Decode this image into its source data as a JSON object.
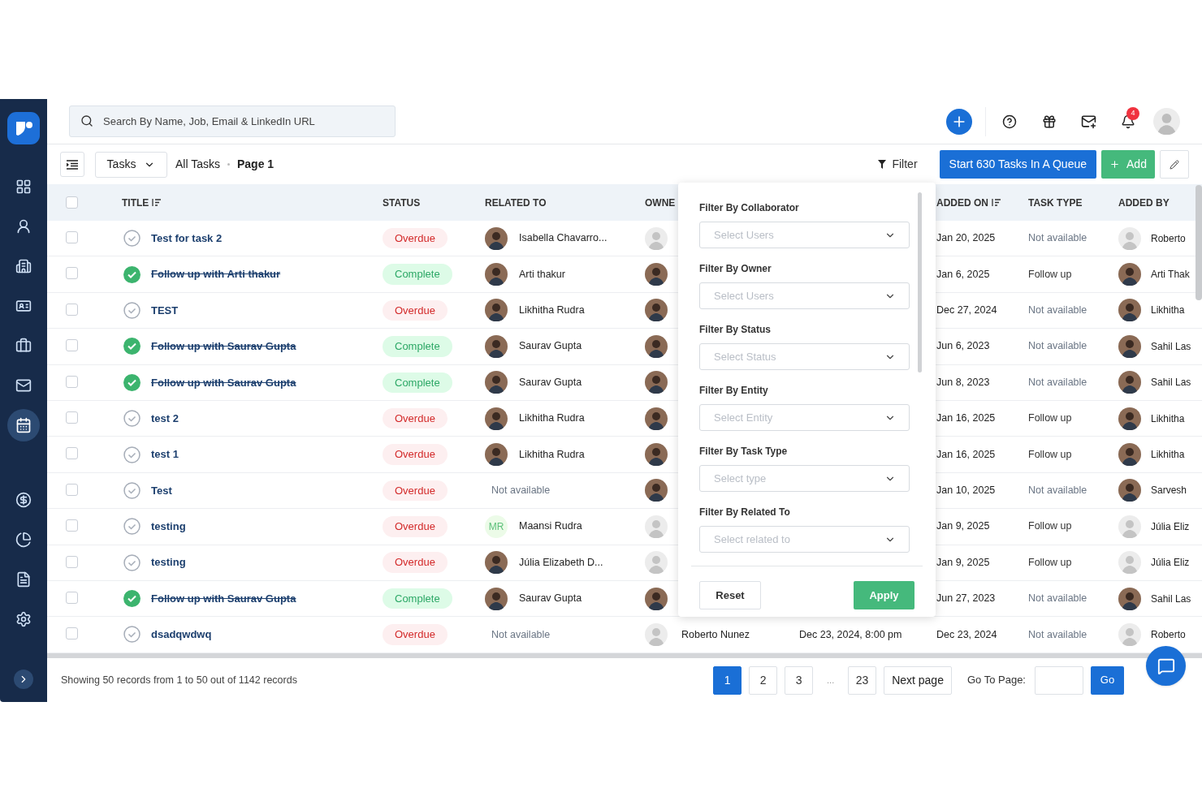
{
  "sidebar": {
    "items": [
      {
        "kind": "grid",
        "selected": false
      },
      {
        "kind": "user",
        "selected": false
      },
      {
        "kind": "building",
        "selected": false
      },
      {
        "kind": "card",
        "selected": false
      },
      {
        "kind": "briefcase",
        "selected": false
      },
      {
        "kind": "mail",
        "selected": false
      },
      {
        "kind": "calendar",
        "selected": true
      },
      {
        "kind": "dollar",
        "selected": false
      },
      {
        "kind": "pie",
        "selected": false
      },
      {
        "kind": "invoice",
        "selected": false
      },
      {
        "kind": "settings",
        "selected": false
      }
    ]
  },
  "header": {
    "search": {
      "placeholder": "Search By Name, Job, Email & LinkedIn URL"
    },
    "notification_count": "4"
  },
  "toolbar": {
    "view": "Tasks",
    "breadcrumb": [
      "All Tasks",
      "Page 1"
    ],
    "filter": "Filter",
    "queue_button": "Start 630 Tasks In A Queue",
    "add_button": "Add"
  },
  "table": {
    "select_all": {
      "checked": false
    },
    "columns": [
      "TITLE",
      "STATUS",
      "RELATED TO",
      "OWNE",
      "ADDED ON",
      "TASK TYPE",
      "ADDED BY"
    ],
    "rows": [
      {
        "checked": false,
        "title": "Test for task 2",
        "done": false,
        "status": {
          "label": "Overdue",
          "kind": "overdue"
        },
        "related": {
          "kind": "photo",
          "name": "Isabella Chavarro..."
        },
        "owner": {
          "kind": "placeholder"
        },
        "added_on": "Jan 20, 2025",
        "task_type": {
          "kind": "none",
          "text": "Not available"
        },
        "added_by": {
          "kind": "placeholder",
          "name": "Roberto"
        }
      },
      {
        "checked": false,
        "title": "Follow up with Arti thakur",
        "done": true,
        "status": {
          "label": "Complete",
          "kind": "complete"
        },
        "related": {
          "kind": "photo",
          "name": "Arti thakur"
        },
        "owner": {
          "kind": "photo"
        },
        "added_on": "Jan 6, 2025",
        "task_type": {
          "kind": "value",
          "text": "Follow up"
        },
        "added_by": {
          "kind": "photo",
          "name": "Arti Thak"
        }
      },
      {
        "checked": false,
        "title": "TEST",
        "done": false,
        "status": {
          "label": "Overdue",
          "kind": "overdue"
        },
        "related": {
          "kind": "photo",
          "name": "Likhitha Rudra"
        },
        "owner": {
          "kind": "photo"
        },
        "added_on": "Dec 27, 2024",
        "task_type": {
          "kind": "none",
          "text": "Not available"
        },
        "added_by": {
          "kind": "photo",
          "name": "Likhitha"
        }
      },
      {
        "checked": false,
        "title": "Follow up with Saurav Gupta",
        "done": true,
        "status": {
          "label": "Complete",
          "kind": "complete"
        },
        "related": {
          "kind": "photo",
          "name": "Saurav Gupta"
        },
        "owner": {
          "kind": "photo"
        },
        "added_on": "Jun 6, 2023",
        "task_type": {
          "kind": "none",
          "text": "Not available"
        },
        "added_by": {
          "kind": "photo",
          "name": "Sahil Las"
        }
      },
      {
        "checked": false,
        "title": "Follow up with Saurav Gupta",
        "done": true,
        "status": {
          "label": "Complete",
          "kind": "complete"
        },
        "related": {
          "kind": "photo",
          "name": "Saurav Gupta"
        },
        "owner": {
          "kind": "photo"
        },
        "added_on": "Jun 8, 2023",
        "task_type": {
          "kind": "none",
          "text": "Not available"
        },
        "added_by": {
          "kind": "photo",
          "name": "Sahil Las"
        }
      },
      {
        "checked": false,
        "title": "test 2",
        "done": false,
        "status": {
          "label": "Overdue",
          "kind": "overdue"
        },
        "related": {
          "kind": "photo",
          "name": "Likhitha Rudra"
        },
        "owner": {
          "kind": "photo"
        },
        "added_on": "Jan 16, 2025",
        "task_type": {
          "kind": "value",
          "text": "Follow up"
        },
        "added_by": {
          "kind": "photo",
          "name": "Likhitha"
        }
      },
      {
        "checked": false,
        "title": "test 1",
        "done": false,
        "status": {
          "label": "Overdue",
          "kind": "overdue"
        },
        "related": {
          "kind": "photo",
          "name": "Likhitha Rudra"
        },
        "owner": {
          "kind": "photo"
        },
        "added_on": "Jan 16, 2025",
        "task_type": {
          "kind": "value",
          "text": "Follow up"
        },
        "added_by": {
          "kind": "photo",
          "name": "Likhitha"
        }
      },
      {
        "checked": false,
        "title": "Test",
        "done": false,
        "status": {
          "label": "Overdue",
          "kind": "overdue"
        },
        "related": {
          "kind": "none",
          "name": "Not available"
        },
        "owner": {
          "kind": "photo"
        },
        "added_on": "Jan 10, 2025",
        "task_type": {
          "kind": "none",
          "text": "Not available"
        },
        "added_by": {
          "kind": "photo",
          "name": "Sarvesh"
        }
      },
      {
        "checked": false,
        "title": "testing",
        "done": false,
        "status": {
          "label": "Overdue",
          "kind": "overdue"
        },
        "related": {
          "kind": "initials",
          "initials": "MR",
          "name": "Maansi Rudra"
        },
        "owner": {
          "kind": "placeholder"
        },
        "added_on": "Jan 9, 2025",
        "task_type": {
          "kind": "value",
          "text": "Follow up"
        },
        "added_by": {
          "kind": "placeholder",
          "name": "Júlia Eliz"
        }
      },
      {
        "checked": false,
        "title": "testing",
        "done": false,
        "status": {
          "label": "Overdue",
          "kind": "overdue"
        },
        "related": {
          "kind": "photo",
          "name": "Júlia Elizabeth D..."
        },
        "owner": {
          "kind": "placeholder"
        },
        "added_on": "Jan 9, 2025",
        "task_type": {
          "kind": "value",
          "text": "Follow up"
        },
        "added_by": {
          "kind": "placeholder",
          "name": "Júlia Eliz"
        }
      },
      {
        "checked": false,
        "title": "Follow up with Saurav Gupta",
        "done": true,
        "status": {
          "label": "Complete",
          "kind": "complete"
        },
        "related": {
          "kind": "photo",
          "name": "Saurav Gupta"
        },
        "owner": {
          "kind": "photo"
        },
        "added_on": "Jun 27, 2023",
        "task_type": {
          "kind": "none",
          "text": "Not available"
        },
        "added_by": {
          "kind": "photo",
          "name": "Sahil Las"
        }
      },
      {
        "checked": false,
        "title": "dsadqwdwq",
        "done": false,
        "status": {
          "label": "Overdue",
          "kind": "overdue"
        },
        "related": {
          "kind": "none",
          "name": "Not available"
        },
        "owner": {
          "kind": "placeholder",
          "name": "Roberto Nunez"
        },
        "due": "Dec 23, 2024, 8:00 pm",
        "added_on": "Dec 23, 2024",
        "task_type": {
          "kind": "none",
          "text": "Not available"
        },
        "added_by": {
          "kind": "placeholder",
          "name": "Roberto"
        }
      }
    ]
  },
  "filter_panel": {
    "fields": [
      {
        "label": "Filter By Collaborator",
        "placeholder": "Select Users"
      },
      {
        "label": "Filter By Owner",
        "placeholder": "Select Users"
      },
      {
        "label": "Filter By Status",
        "placeholder": "Select Status"
      },
      {
        "label": "Filter By Entity",
        "placeholder": "Select Entity"
      },
      {
        "label": "Filter By Task Type",
        "placeholder": "Select type"
      },
      {
        "label": "Filter By Related To",
        "placeholder": "Select related to"
      }
    ],
    "reset": "Reset",
    "apply": "Apply"
  },
  "footer": {
    "summary": "Showing 50 records from 1 to 50 out of 1142 records",
    "pages": [
      {
        "kind": "page",
        "label": "1",
        "selected": true
      },
      {
        "kind": "page",
        "label": "2",
        "selected": false
      },
      {
        "kind": "page",
        "label": "3",
        "selected": false
      },
      {
        "kind": "gap",
        "label": "..."
      },
      {
        "kind": "page",
        "label": "23",
        "selected": false
      }
    ],
    "next": "Next page",
    "goto_label": "Go To Page:",
    "go": "Go"
  }
}
